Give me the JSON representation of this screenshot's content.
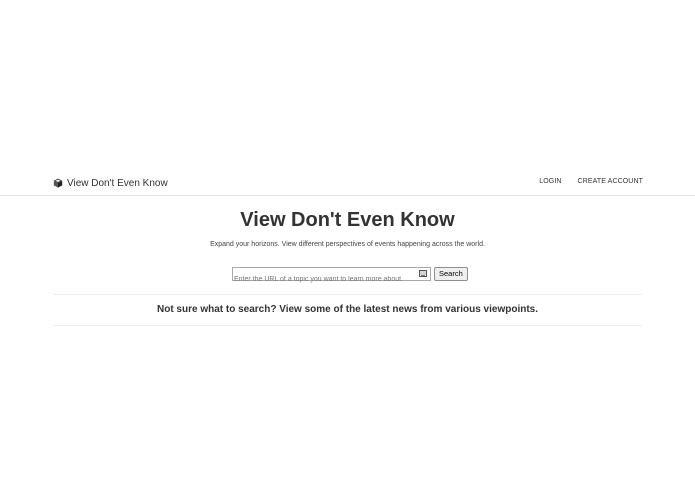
{
  "navbar": {
    "brand_icon": "cube-icon",
    "brand_title": "View Don't Even Know",
    "login_label": "LOGIN",
    "create_account_label": "CREATE ACCOUNT"
  },
  "hero": {
    "title": "View Don't Even Know",
    "subtitle": "Expand your horizons. View different perspectives of events happening across the world."
  },
  "search": {
    "placeholder": "Enter the URL of a topic you want to learn more about.",
    "value": "",
    "input_icon": "keyboard-icon",
    "button_label": "Search"
  },
  "news": {
    "prompt": "Not sure what to search? View some of the latest news from various viewpoints."
  }
}
